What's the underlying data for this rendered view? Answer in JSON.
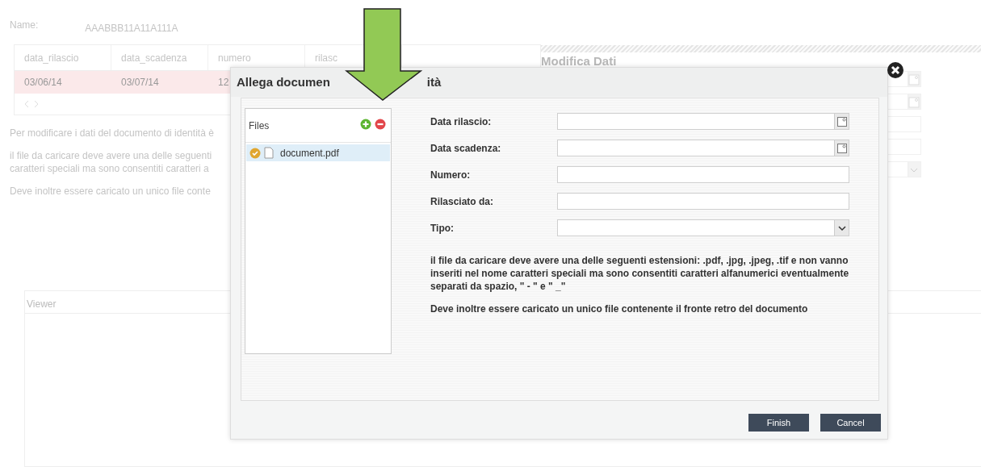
{
  "page": {
    "name_label": "Name:",
    "name_value": "AAABBB11A11A111A",
    "table": {
      "columns": [
        "data_rilascio",
        "data_scadenza",
        "numero",
        "rilasc"
      ],
      "rows": [
        {
          "cells": [
            "03/06/14",
            "03/07/14",
            "12"
          ],
          "selected": true
        }
      ]
    },
    "notes": [
      "Per modificare i dati del documento di identità è",
      "il file da caricare deve avere una delle seguenti\ncaratteri speciali ma sono consentiti caratteri a",
      "Deve inoltre essere caricato un unico file conte"
    ],
    "side_panel": {
      "title": "Modifica Dati",
      "fields": [
        {
          "kind": "date"
        },
        {
          "kind": "date"
        },
        {
          "kind": "text"
        },
        {
          "kind": "text"
        },
        {
          "kind": "select"
        }
      ]
    },
    "viewer": {
      "title": "Viewer"
    }
  },
  "dialog": {
    "title_parts": [
      "Allega documen",
      "ità"
    ],
    "files_panel": {
      "title": "Files",
      "files": [
        {
          "name": "document.pdf",
          "selected": true
        }
      ]
    },
    "fields": [
      {
        "label": "Data rilascio:",
        "kind": "date"
      },
      {
        "label": "Data scadenza:",
        "kind": "date"
      },
      {
        "label": "Numero:",
        "kind": "text"
      },
      {
        "label": "Rilasciato da:",
        "kind": "text"
      },
      {
        "label": "Tipo:",
        "kind": "select"
      }
    ],
    "notes": [
      "il file da caricare deve avere una delle seguenti estensioni: .pdf, .jpg, .jpeg, .tif e non vanno inseriti nel nome caratteri speciali ma sono consentiti caratteri alfanumerici eventualmente separati da spazio, \" - \" e \" _\"",
      "Deve inoltre essere caricato un unico file contenente il fronte retro del documento"
    ],
    "buttons": [
      {
        "label": "Finish"
      },
      {
        "label": "Cancel"
      }
    ]
  }
}
